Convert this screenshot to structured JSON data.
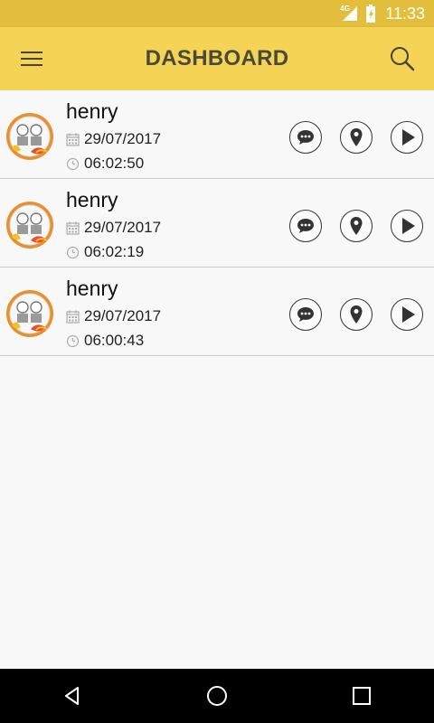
{
  "status_bar": {
    "network": "4G",
    "time": "11:33"
  },
  "app_bar": {
    "title": "DASHBOARD",
    "menu_icon": "hamburger-menu-icon",
    "search_icon": "search-icon"
  },
  "colors": {
    "status_bar": "#e3be3c",
    "app_bar": "#f5d455",
    "background": "#f8f8f8",
    "nav_bar": "#000000"
  },
  "records": [
    {
      "name": "henry",
      "date": "29/07/2017",
      "time": "06:02:50"
    },
    {
      "name": "henry",
      "date": "29/07/2017",
      "time": "06:02:19"
    },
    {
      "name": "henry",
      "date": "29/07/2017",
      "time": "06:00:43"
    }
  ],
  "row_actions": [
    "message-icon",
    "location-pin-icon",
    "play-icon"
  ],
  "nav_bar": [
    "back-icon",
    "home-icon",
    "recents-icon"
  ]
}
